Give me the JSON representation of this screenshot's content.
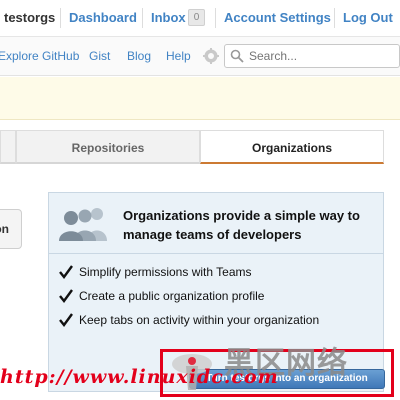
{
  "userbar": {
    "username": "testorgs",
    "dashboard_label": "Dashboard",
    "inbox_label": "Inbox",
    "inbox_count": "0",
    "account_settings_label": "Account Settings",
    "logout_label": "Log Out"
  },
  "nav": {
    "explore_label": "Explore GitHub",
    "gist_label": "Gist",
    "blog_label": "Blog",
    "help_label": "Help",
    "search_placeholder": "Search..."
  },
  "tabs": {
    "repositories_label": "Repositories",
    "organizations_label": "Organizations"
  },
  "left_button_label": "on",
  "promo": {
    "title": "Organizations provide a simple way to manage teams of developers",
    "features": [
      "Simplify permissions with Teams",
      "Create a public organization profile",
      "Keep tabs on activity within your organization"
    ],
    "cta_label": "Turn testorgs into an organization"
  },
  "watermark": {
    "chinese_text": "黑区网络",
    "url_text": "http://www.linuxidc.com"
  },
  "colors": {
    "link": "#4183c4",
    "active_tab_underline": "#cc7a33",
    "promo_background": "#eaf2f8",
    "watermark_red": "#e3001b"
  }
}
